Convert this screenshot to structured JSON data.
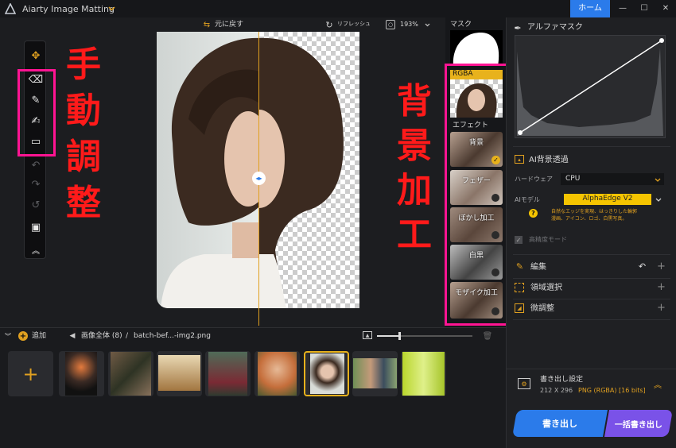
{
  "app": {
    "title": "Aiarty Image Matting",
    "home_label": "ホーム"
  },
  "window_controls": {
    "minimize": "—",
    "maximize": "☐",
    "close": "✕"
  },
  "top_bar": {
    "undo_label": "元に戻す",
    "refresh_label": "リフレッシュ",
    "zoom": "193%"
  },
  "overlay_text": {
    "left": [
      "手",
      "動",
      "調",
      "整"
    ],
    "right": [
      "背",
      "景",
      "加",
      "工"
    ]
  },
  "preview": {
    "mask_label": "マスク",
    "rgba_label": "RGBA",
    "effects_label": "エフェクト",
    "effects": [
      {
        "label": "背景",
        "selected": true
      },
      {
        "label": "フェザー",
        "selected": false
      },
      {
        "label": "ぼかし加工",
        "selected": false
      },
      {
        "label": "白黒",
        "selected": false
      },
      {
        "label": "モザイク加工",
        "selected": false
      }
    ]
  },
  "right_panel": {
    "alpha_mask_label": "アルファマスク",
    "ai_bg_label": "AI背景透過",
    "hardware_label": "ハードウェア",
    "hardware_value": "CPU",
    "ai_model_label": "AIモデル",
    "ai_model_value": "AlphaEdge  V2",
    "model_desc": "自然なエッジを実現、はっきりした輪郭\n漫画、アイコン、ロゴ、白黒写真。",
    "hq_mode_label": "高精度モード",
    "edit_label": "編集",
    "region_select_label": "領域選択",
    "fine_tune_label": "微調整",
    "export_settings_label": "書き出し設定",
    "export_dims": "212 X 296",
    "export_format": "PNG (RGBA) [16 bits]",
    "export_button": "書き出し",
    "batch_export_button": "一括書き出し"
  },
  "bottom_bar": {
    "add_label": "追加",
    "all_images": "画像全体 (8)",
    "separator": "/",
    "file_name": "batch-bef...-img2.png"
  },
  "thumbnails": [
    "jellyfish",
    "forest-log",
    "bicycle",
    "forest-woman",
    "flowers-woman",
    "bob-hair-woman",
    "two-people",
    "bottle"
  ],
  "colors": {
    "accent": "#2b7bea",
    "highlight": "#ff1493",
    "model_yellow": "#f5c400",
    "selected_frame": "#e8b21c",
    "red_text": "#ff1a1a"
  }
}
